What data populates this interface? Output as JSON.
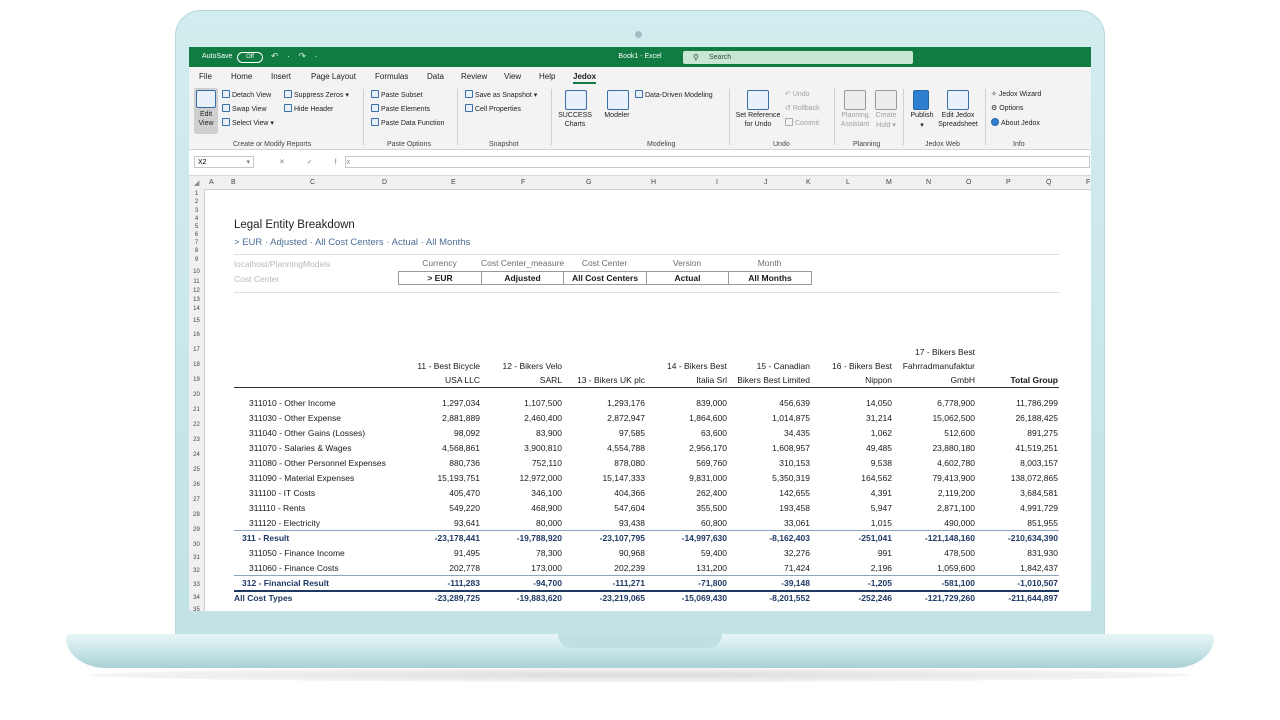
{
  "titlebar": {
    "autosave_label": "AutoSave",
    "autosave_state": "Off",
    "quick_access": "↶ · ↷ ·",
    "doc_title": "Book1 - Excel",
    "search_placeholder": "Search"
  },
  "menu": [
    "File",
    "Home",
    "Insert",
    "Page Layout",
    "Formulas",
    "Data",
    "Review",
    "View",
    "Help",
    "Jedox"
  ],
  "ribbon": {
    "edit_view_line1": "Edit",
    "edit_view_line2": "View",
    "detach_view": "Detach View",
    "swap_view": "Swap View",
    "select_view": "Select View ▾",
    "suppress_zeros": "Suppress Zeros ▾",
    "hide_header": "Hide Header",
    "group_create": "Create or Modify Reports",
    "paste_subset": "Paste Subset",
    "paste_elements": "Paste Elements",
    "paste_data_function": "Paste Data Function",
    "group_paste": "Paste Options",
    "save_as_snapshot": "Save as Snapshot ▾",
    "cell_properties": "Cell Properties",
    "group_snapshot": "Snapshot",
    "success_charts_line1": "SUCCESS",
    "success_charts_line2": "Charts",
    "modeler": "Modeler",
    "data_driven_modeling": "Data-Driven Modeling",
    "group_modeling": "Modeling",
    "set_reference_line1": "Set Reference",
    "set_reference_line2": "for Undo",
    "undo": "Undo",
    "rollback": "Rollback",
    "commit": "Commit",
    "group_undo": "Undo",
    "planning_assistant_line1": "Planning",
    "planning_assistant_line2": "Assistant",
    "create_hold_line1": "Create",
    "create_hold_line2": "Hold ▾",
    "group_planning": "Planning",
    "publish": "Publish",
    "publish_arrow": "▾",
    "edit_jedox_line1": "Edit Jedox",
    "edit_jedox_line2": "Spreadsheet",
    "group_jedoxweb": "Jedox Web",
    "jedox_wizard": "Jedox Wizard",
    "options": "Options",
    "about_jedox": "About Jedox",
    "group_info": "Info"
  },
  "formula_bar": {
    "name_box": "X2",
    "fx_symbols": "✕ ✓ fx",
    "formula": ""
  },
  "columns": [
    "A",
    "B",
    "C",
    "D",
    "E",
    "F",
    "G",
    "H",
    "I",
    "J",
    "K",
    "L",
    "M",
    "N",
    "O",
    "P",
    "Q",
    "F"
  ],
  "rows": [
    "1",
    "2",
    "3",
    "4",
    "5",
    "6",
    "7",
    "8",
    "9",
    "10",
    "11",
    "12",
    "13",
    "14",
    "15",
    "16",
    "17",
    "18",
    "19",
    "20",
    "21",
    "22",
    "23",
    "24",
    "25",
    "26",
    "27",
    "28",
    "29",
    "30",
    "31",
    "32",
    "33",
    "34",
    "35"
  ],
  "report": {
    "title": "Legal Entity Breakdown",
    "subtitle": "> EUR · Adjusted · All Cost Centers · Actual · All Months",
    "server_path": "localhost/PlanningModels",
    "cost_center_label": "Cost Center",
    "filters": [
      {
        "label": "Currency",
        "value": "> EUR"
      },
      {
        "label": "Cost Center_measure",
        "value": "Adjusted"
      },
      {
        "label": "Cost Center",
        "value": "All Cost Centers"
      },
      {
        "label": "Version",
        "value": "Actual"
      },
      {
        "label": "Month",
        "value": "All Months"
      }
    ],
    "headers": [
      {
        "line1": "",
        "line2": "11 - Best Bicycle",
        "line3": "USA LLC"
      },
      {
        "line1": "",
        "line2": "12 - Bikers Velo",
        "line3": "SARL"
      },
      {
        "line1": "",
        "line2": "",
        "line3": "13 - Bikers UK plc"
      },
      {
        "line1": "",
        "line2": "14 - Bikers Best",
        "line3": "Italia Srl"
      },
      {
        "line1": "",
        "line2": "15 - Canadian",
        "line3": "Bikers Best Limited"
      },
      {
        "line1": "",
        "line2": "16 - Bikers Best",
        "line3": "Nippon"
      },
      {
        "line1": "17 - Bikers Best",
        "line2": "Fahrradmanufaktur",
        "line3": "GmbH"
      },
      {
        "line1": "",
        "line2": "",
        "line3": "Total Group"
      }
    ],
    "rows": [
      {
        "label": "311010 - Other Income",
        "type": "detail",
        "values": [
          "1,297,034",
          "1,107,500",
          "1,293,176",
          "839,000",
          "456,639",
          "14,050",
          "6,778,900",
          "11,786,299"
        ]
      },
      {
        "label": "311030 - Other Expense",
        "type": "detail",
        "values": [
          "2,881,889",
          "2,460,400",
          "2,872,947",
          "1,864,600",
          "1,014,875",
          "31,214",
          "15,062,500",
          "26,188,425"
        ]
      },
      {
        "label": "311040 - Other Gains (Losses)",
        "type": "detail",
        "values": [
          "98,092",
          "83,900",
          "97,585",
          "63,600",
          "34,435",
          "1,062",
          "512,600",
          "891,275"
        ]
      },
      {
        "label": "311070 - Salaries & Wages",
        "type": "detail",
        "values": [
          "4,568,861",
          "3,900,810",
          "4,554,788",
          "2,956,170",
          "1,608,957",
          "49,485",
          "23,880,180",
          "41,519,251"
        ]
      },
      {
        "label": "311080 - Other Personnel Expenses",
        "type": "detail",
        "values": [
          "880,736",
          "752,110",
          "878,080",
          "569,760",
          "310,153",
          "9,538",
          "4,602,780",
          "8,003,157"
        ]
      },
      {
        "label": "311090 - Material Expenses",
        "type": "detail",
        "values": [
          "15,193,751",
          "12,972,000",
          "15,147,333",
          "9,831,000",
          "5,350,319",
          "164,562",
          "79,413,900",
          "138,072,865"
        ]
      },
      {
        "label": "311100 - IT Costs",
        "type": "detail",
        "values": [
          "405,470",
          "346,100",
          "404,366",
          "262,400",
          "142,655",
          "4,391",
          "2,119,200",
          "3,684,581"
        ]
      },
      {
        "label": "311110 - Rents",
        "type": "detail",
        "values": [
          "549,220",
          "468,900",
          "547,604",
          "355,500",
          "193,458",
          "5,947",
          "2,871,100",
          "4,991,729"
        ]
      },
      {
        "label": "311120 - Electricity",
        "type": "detail",
        "values": [
          "93,641",
          "80,000",
          "93,438",
          "60,800",
          "33,061",
          "1,015",
          "490,000",
          "851,955"
        ]
      },
      {
        "label": "311 - Result",
        "type": "subtotal",
        "values": [
          "-23,178,441",
          "-19,788,920",
          "-23,107,795",
          "-14,997,630",
          "-8,162,403",
          "-251,041",
          "-121,148,160",
          "-210,634,390"
        ]
      },
      {
        "label": "311050 - Finance Income",
        "type": "detail",
        "values": [
          "91,495",
          "78,300",
          "90,968",
          "59,400",
          "32,276",
          "991",
          "478,500",
          "831,930"
        ]
      },
      {
        "label": "311060 - Finance Costs",
        "type": "detail",
        "values": [
          "202,778",
          "173,000",
          "202,239",
          "131,200",
          "71,424",
          "2,196",
          "1,059,600",
          "1,842,437"
        ]
      },
      {
        "label": "312 - Financial Result",
        "type": "subtotal",
        "values": [
          "-111,283",
          "-94,700",
          "-111,271",
          "-71,800",
          "-39,148",
          "-1,205",
          "-581,100",
          "-1,010,507"
        ]
      },
      {
        "label": "All Cost Types",
        "type": "total",
        "values": [
          "-23,289,725",
          "-19,883,620",
          "-23,219,065",
          "-15,069,430",
          "-8,201,552",
          "-252,246",
          "-121,729,260",
          "-211,644,897"
        ]
      }
    ]
  }
}
